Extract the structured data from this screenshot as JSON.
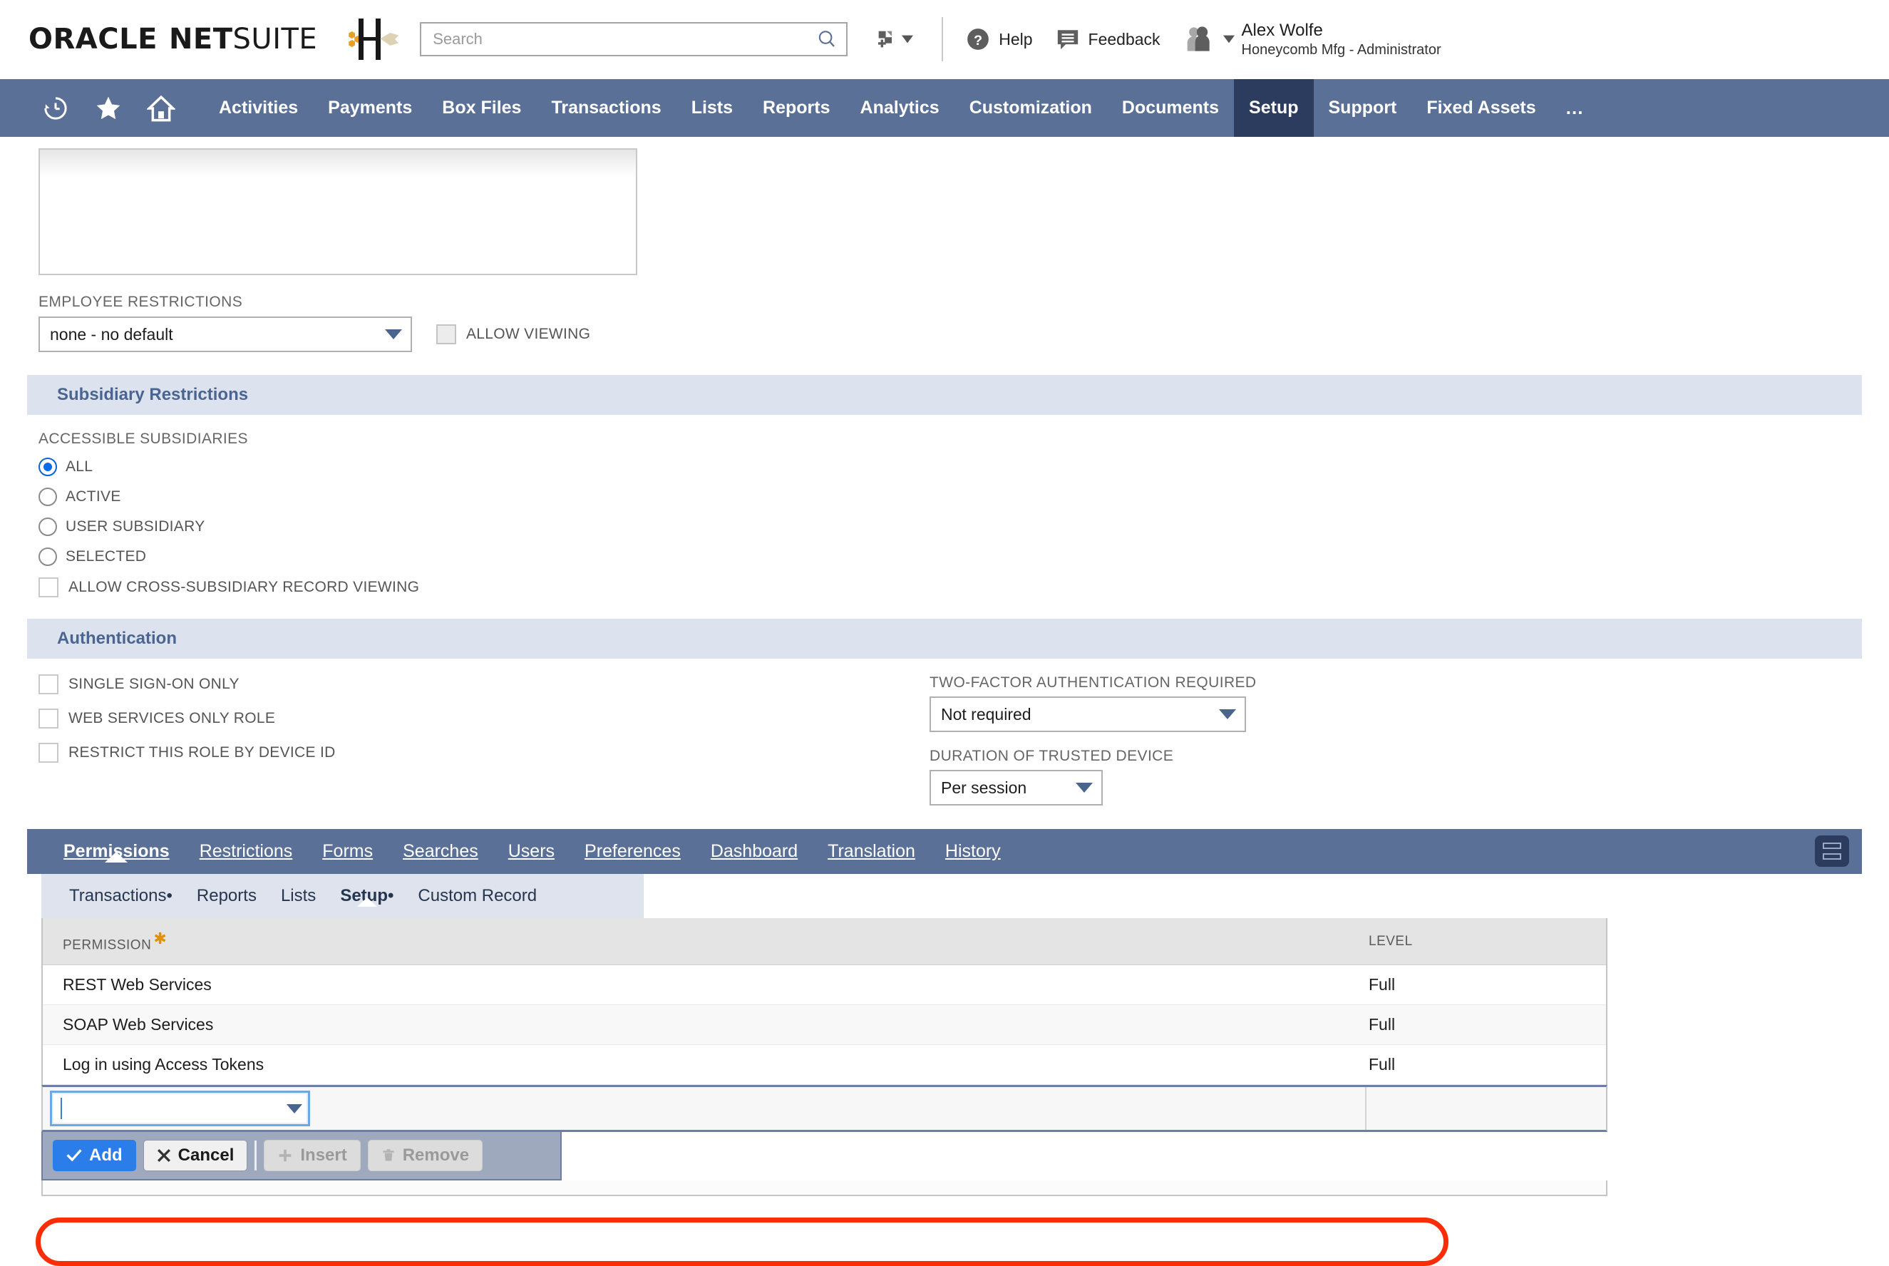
{
  "brand": {
    "oracle": "ORACLE",
    "net": "NET",
    "suite": "SUITE",
    "company_logo_alt": "honeycomb-mfg-logo"
  },
  "topbar": {
    "search": {
      "placeholder": "Search",
      "value": ""
    },
    "quick_add_label": "",
    "help_label": "Help",
    "feedback_label": "Feedback",
    "user_name": "Alex Wolfe",
    "user_role": "Honeycomb Mfg - Administrator"
  },
  "nav": {
    "items": [
      {
        "label": "Activities",
        "active": false
      },
      {
        "label": "Payments",
        "active": false
      },
      {
        "label": "Box Files",
        "active": false
      },
      {
        "label": "Transactions",
        "active": false
      },
      {
        "label": "Lists",
        "active": false
      },
      {
        "label": "Reports",
        "active": false
      },
      {
        "label": "Analytics",
        "active": false
      },
      {
        "label": "Customization",
        "active": false
      },
      {
        "label": "Documents",
        "active": false
      },
      {
        "label": "Setup",
        "active": true
      },
      {
        "label": "Support",
        "active": false
      },
      {
        "label": "Fixed Assets",
        "active": false
      }
    ],
    "overflow_label": "…"
  },
  "form": {
    "employee_restrictions_label": "EMPLOYEE RESTRICTIONS",
    "employee_restrictions_value": "none - no default",
    "allow_viewing_label": "ALLOW VIEWING",
    "allow_viewing_checked": false
  },
  "subsidiary": {
    "section_title": "Subsidiary Restrictions",
    "accessible_label": "ACCESSIBLE SUBSIDIARIES",
    "options": [
      {
        "label": "ALL",
        "selected": true
      },
      {
        "label": "ACTIVE",
        "selected": false
      },
      {
        "label": "USER SUBSIDIARY",
        "selected": false
      },
      {
        "label": "SELECTED",
        "selected": false
      }
    ],
    "cross_subsidiary_label": "ALLOW CROSS-SUBSIDIARY RECORD VIEWING",
    "cross_subsidiary_checked": false
  },
  "authentication": {
    "section_title": "Authentication",
    "checkboxes": [
      {
        "label": "SINGLE SIGN-ON ONLY",
        "checked": false
      },
      {
        "label": "WEB SERVICES ONLY ROLE",
        "checked": false
      },
      {
        "label": "RESTRICT THIS ROLE BY DEVICE ID",
        "checked": false
      }
    ],
    "two_factor_label": "TWO-FACTOR AUTHENTICATION REQUIRED",
    "two_factor_value": "Not required",
    "duration_label": "DURATION OF TRUSTED DEVICE",
    "duration_value": "Per session"
  },
  "tabs": {
    "items": [
      {
        "label": "Permissions",
        "accel": "P",
        "active": true
      },
      {
        "label": "Restrictions",
        "accel": "R",
        "active": false
      },
      {
        "label": "Forms",
        "accel": "F",
        "active": false
      },
      {
        "label": "Searches",
        "accel": "S",
        "active": false
      },
      {
        "label": "Users",
        "accel": "U",
        "active": false
      },
      {
        "label": "Preferences",
        "accel": "f",
        "active": false
      },
      {
        "label": "Dashboard",
        "accel": "D",
        "active": false
      },
      {
        "label": "Translation",
        "accel": "T",
        "active": false
      },
      {
        "label": "History",
        "accel": "H",
        "active": false
      }
    ],
    "view_toggle_name": "list-view-toggle"
  },
  "subtabs": {
    "items": [
      {
        "label": "Transactions",
        "has_dot": true,
        "active": false
      },
      {
        "label": "Reports",
        "has_dot": false,
        "active": false
      },
      {
        "label": "Lists",
        "has_dot": false,
        "active": false
      },
      {
        "label": "Setup",
        "has_dot": true,
        "active": true
      },
      {
        "label": "Custom Record",
        "has_dot": false,
        "active": false
      }
    ]
  },
  "table": {
    "columns": [
      {
        "label": "PERMISSION",
        "required": true
      },
      {
        "label": "LEVEL",
        "required": false
      }
    ],
    "rows": [
      {
        "permission": "REST Web Services",
        "level": "Full",
        "highlighted": false
      },
      {
        "permission": "SOAP Web Services",
        "level": "Full",
        "highlighted": false
      },
      {
        "permission": "Log in using Access Tokens",
        "level": "Full",
        "highlighted": true
      }
    ],
    "new_row": {
      "permission": "",
      "level": ""
    }
  },
  "buttons": {
    "add": "Add",
    "cancel": "Cancel",
    "insert": "Insert",
    "remove": "Remove"
  },
  "colors": {
    "nav_bg": "#5b7096",
    "nav_active": "#2c3c5e",
    "section_header_bg": "#dde3ee",
    "section_header_text": "#4a6591",
    "primary_button": "#2b7de9",
    "annotation": "#fb2d08",
    "required_star": "#e09000"
  }
}
